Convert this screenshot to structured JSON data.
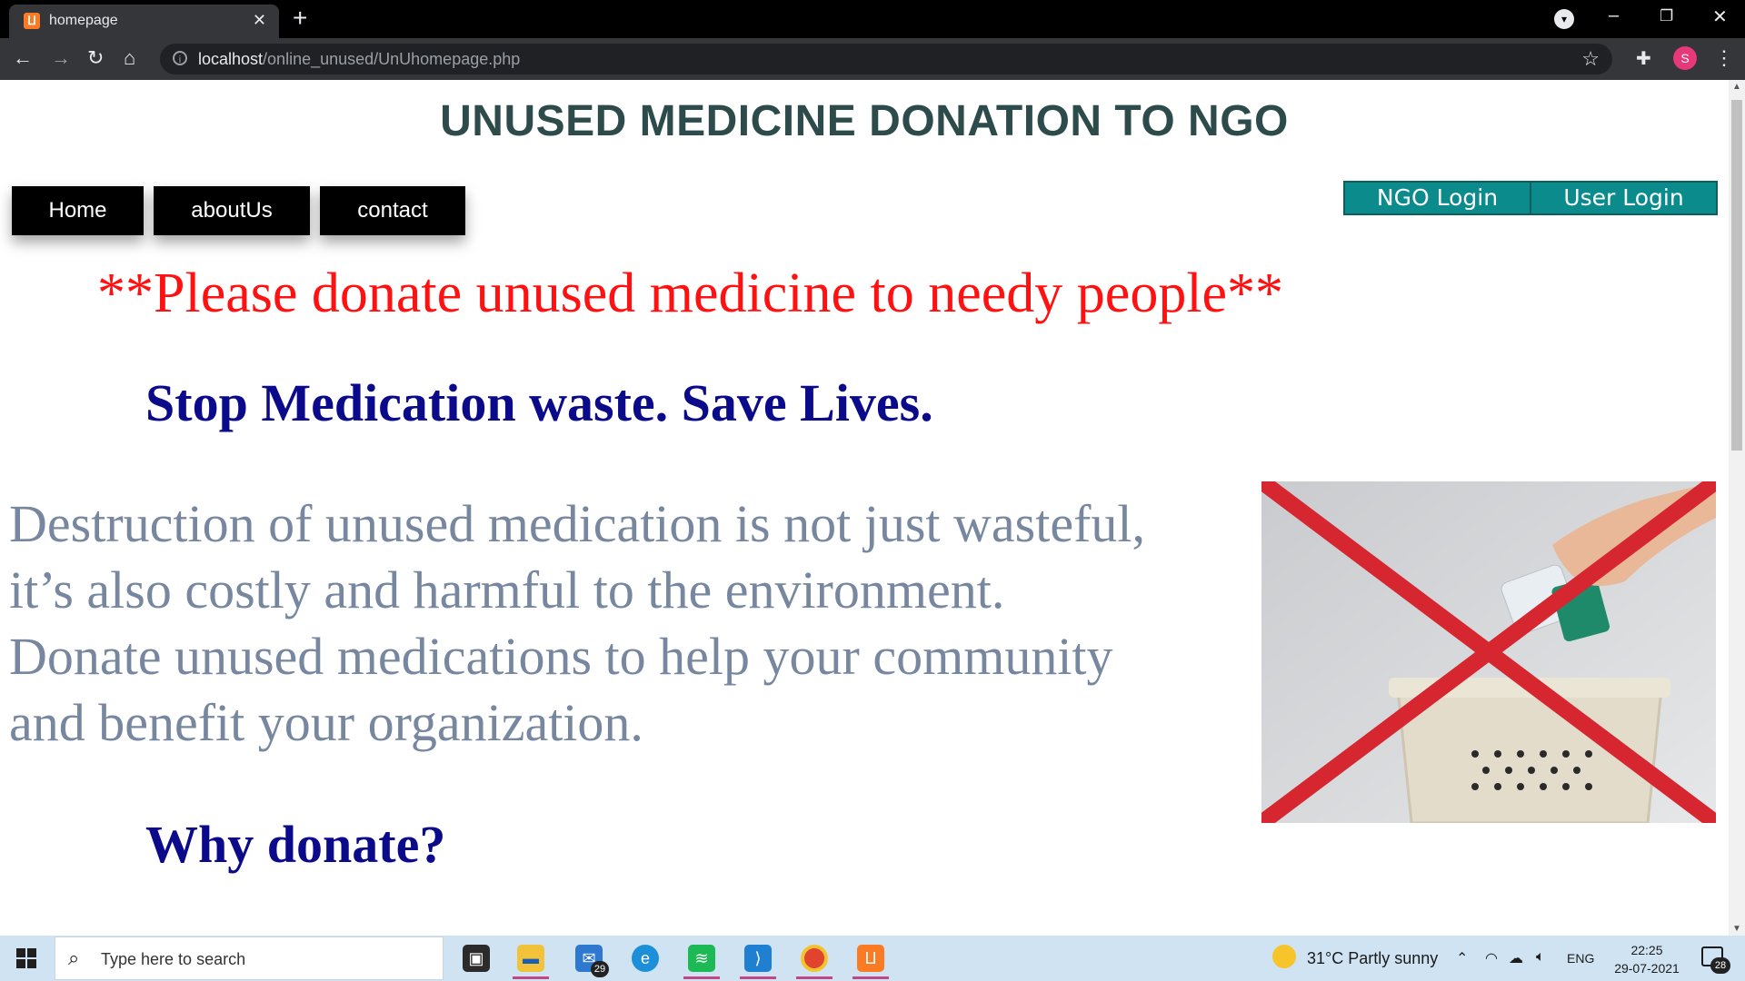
{
  "browser": {
    "tab_title": "homepage",
    "url_host": "localhost",
    "url_path": "/online_unused/UnUhomepage.php",
    "profile_initial": "S"
  },
  "page": {
    "title": "UNUSED MEDICINE DONATION TO NGO",
    "nav": [
      "Home",
      "aboutUs",
      "contact"
    ],
    "login": {
      "ngo": "NGO Login",
      "user": "User Login"
    },
    "appeal": "**Please donate unused medicine to needy people**",
    "slogan": "Stop Medication waste. Save Lives.",
    "description_lines": [
      "Destruction of unused medication is not just wasteful,",
      "it’s also costly and harmful to the environment.",
      "Donate unused medications to help your community",
      "and benefit your organization."
    ],
    "why_heading": "Why donate?",
    "colors": {
      "title": "#2e4b4b",
      "appeal": "#ff1111",
      "heading": "#0a0a8a",
      "body": "#7787a0",
      "login_bg": "#0b8b8b",
      "cross": "#d62630"
    }
  },
  "taskbar": {
    "search_placeholder": "Type here to search",
    "mail_badge": "29",
    "weather": "31°C  Partly sunny",
    "language": "ENG",
    "time": "22:25",
    "date": "29-07-2021",
    "notification_count": "28"
  }
}
